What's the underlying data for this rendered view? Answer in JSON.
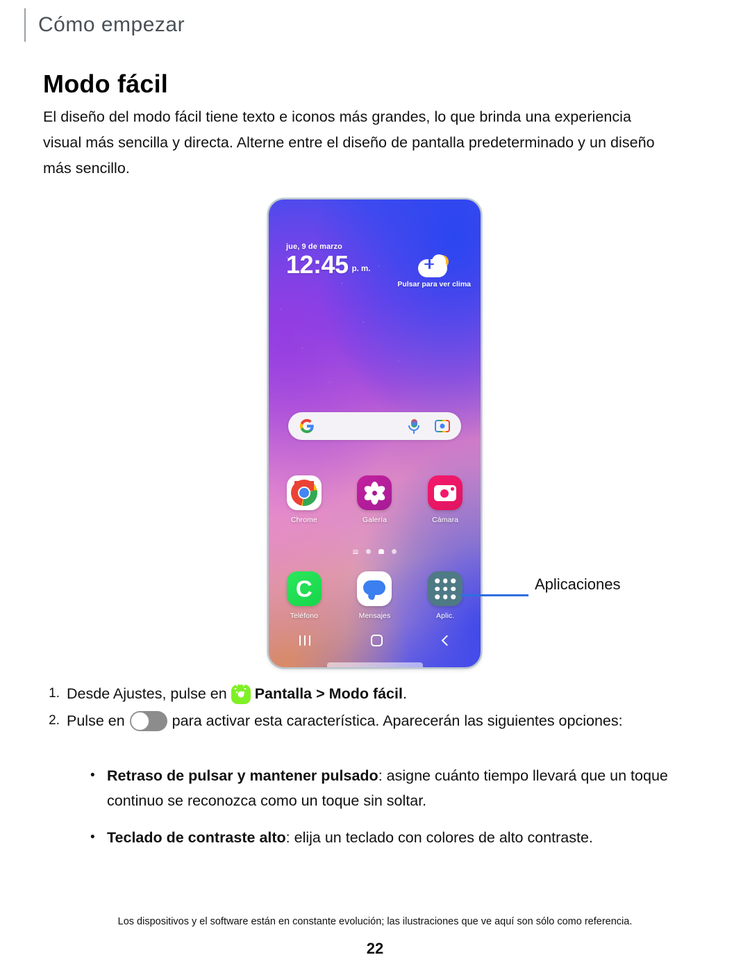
{
  "running_head": "Cómo empezar",
  "title": "Modo fácil",
  "intro": "El diseño del modo fácil tiene texto e iconos más grandes, lo que brinda una experiencia visual más sencilla y directa. Alterne entre el diseño de pantalla predeterminado y un diseño más sencillo.",
  "phone": {
    "clock": {
      "date": "jue, 9 de marzo",
      "time": "12:45",
      "ampm": "p. m."
    },
    "weather": {
      "label": "Pulsar para ver clima",
      "icon": "cloud-plus-sun-icon",
      "sun_color": "#ffb521",
      "plus_color": "#3a4ef0"
    },
    "search": {
      "google_icon": "google-g-icon",
      "mic_icon": "microphone-icon",
      "lens_icon": "google-lens-icon"
    },
    "apps_row1": [
      {
        "label": "Chrome",
        "icon": "chrome-icon"
      },
      {
        "label": "Galería",
        "icon": "gallery-flower-icon"
      },
      {
        "label": "Cámara",
        "icon": "camera-icon"
      }
    ],
    "apps_row2": [
      {
        "label": "Teléfono",
        "icon": "phone-icon"
      },
      {
        "label": "Mensajes",
        "icon": "messages-bubble-icon"
      },
      {
        "label": "Aplic.",
        "icon": "apps-grid-icon"
      }
    ],
    "nav": {
      "recents": "recents-icon",
      "home": "home-icon",
      "back": "back-icon"
    }
  },
  "callout": {
    "label": "Aplicaciones",
    "line_color": "#2f6fe0"
  },
  "steps": [
    {
      "num": "1.",
      "pre": "Desde Ajustes, pulse en",
      "icon": "display-brightness-icon",
      "icon_color": "#7ff024",
      "bold1": "Pantalla",
      "sep": " > ",
      "bold2": "Modo fácil",
      "post": "."
    },
    {
      "num": "2.",
      "pre": "Pulse en",
      "icon": "toggle-switch-off",
      "post": "para activar esta característica. Aparecerán las siguientes opciones:"
    }
  ],
  "bullets": [
    {
      "dot": "•",
      "bold": "Retraso de pulsar y mantener pulsado",
      "text": ": asigne cuánto tiempo llevará que un toque continuo se reconozca como un toque sin soltar."
    },
    {
      "dot": "•",
      "bold": "Teclado de contraste alto",
      "text": ": elija un teclado con colores de alto contraste."
    }
  ],
  "footer": {
    "note": "Los dispositivos y el software están en constante evolución; las ilustraciones que ve aquí son sólo como referencia.",
    "page": "22"
  }
}
